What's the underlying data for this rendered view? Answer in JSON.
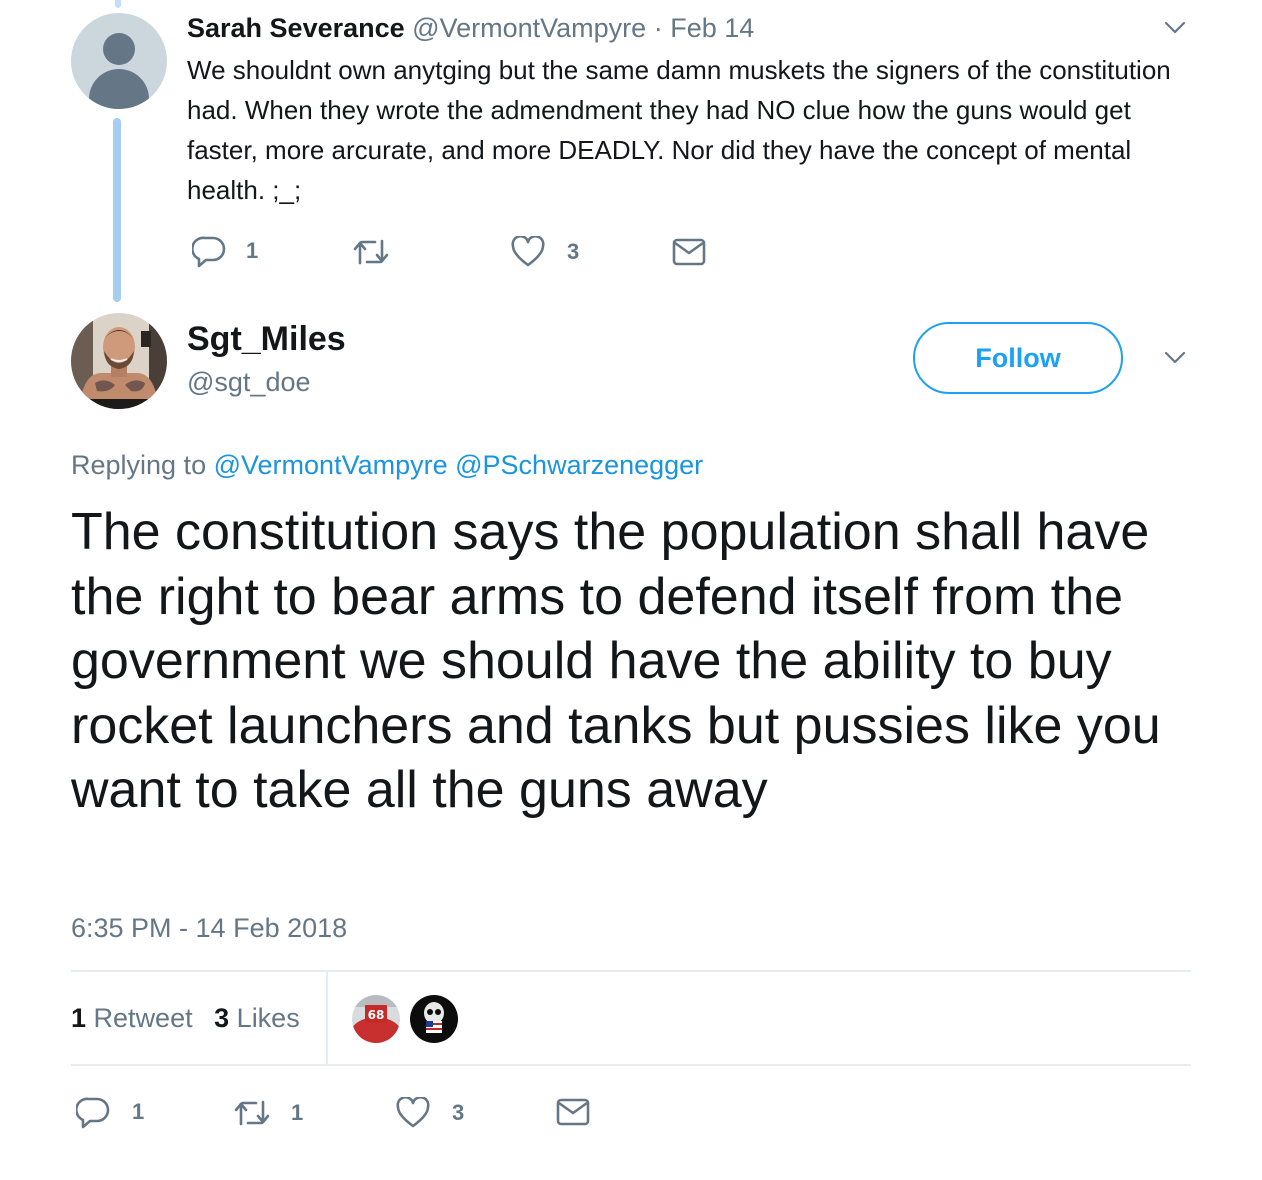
{
  "reply_tweet": {
    "author_name": "Sarah Severance",
    "author_handle": "@VermontVampyre",
    "separator": "·",
    "date": "Feb 14",
    "text": "We shouldnt own anytging but the same damn muskets the signers of the constitution had. When they wrote the admendment they had NO clue how the guns would get faster, more arcurate, and more DEADLY. Nor did they have the concept of mental health. ;_;",
    "reply_count": "1",
    "retweet_count": "",
    "like_count": "3"
  },
  "main_tweet": {
    "author_name": "Sgt_Miles",
    "author_handle": "@sgt_doe",
    "follow_label": "Follow",
    "replying_prefix": "Replying to",
    "replying_mentions": [
      "@VermontVampyre",
      "@PSchwarzenegger"
    ],
    "text": "The constitution says the population shall have the right to bear arms to defend itself from the government we should have the ability to buy rocket launchers and tanks but pussies like you want to take all the guns away",
    "timestamp": "6:35 PM - 14 Feb 2018",
    "stats": {
      "retweets_number": "1",
      "retweets_label": "Retweet",
      "likes_number": "3",
      "likes_label": "Likes"
    },
    "liker_badge_text": "68",
    "actions": {
      "reply_count": "1",
      "retweet_count": "1",
      "like_count": "3"
    }
  },
  "colors": {
    "accent": "#1da1f2",
    "mention": "#1b95e0",
    "muted": "#657786",
    "thread_line": "#a6cdf2",
    "divider": "#e6ecf0"
  },
  "icons": [
    "reply-icon",
    "retweet-icon",
    "like-icon",
    "direct-message-icon",
    "chevron-down-icon"
  ]
}
